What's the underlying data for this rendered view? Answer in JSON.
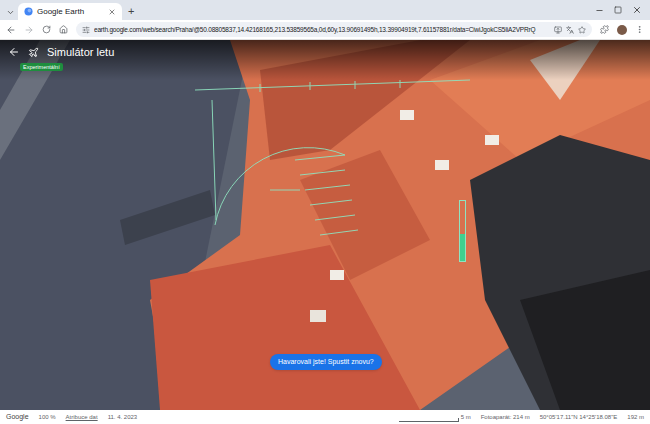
{
  "browser": {
    "tabs": [
      {
        "title": "Google Earth",
        "selected": true
      }
    ],
    "new_tab": "+",
    "address": "earth.google.com/web/search/Praha/@50.08805837,14.42168165,213.53859565a,0d,60y,13.90691495h,13.39904919t,7.61157881r/data=CiwiJgokCS5IiA2VPRrQ"
  },
  "header": {
    "title": "Simulátor letu",
    "badge": "Experimentální"
  },
  "crash_prompt": "Havarovali jste! Spustit znovu?",
  "hud": {
    "throttle_level": 0.45
  },
  "status_bar": {
    "logo": "Google",
    "zoom": "100 %",
    "attribution": "Atribuce dat",
    "date": "11. 4. 2023",
    "scale": "5 m",
    "camera": "Fotoaparát: 214 m",
    "coordinates": "50°05'17.11\"N 14°25'18.08\"E",
    "elevation": "192 m"
  }
}
